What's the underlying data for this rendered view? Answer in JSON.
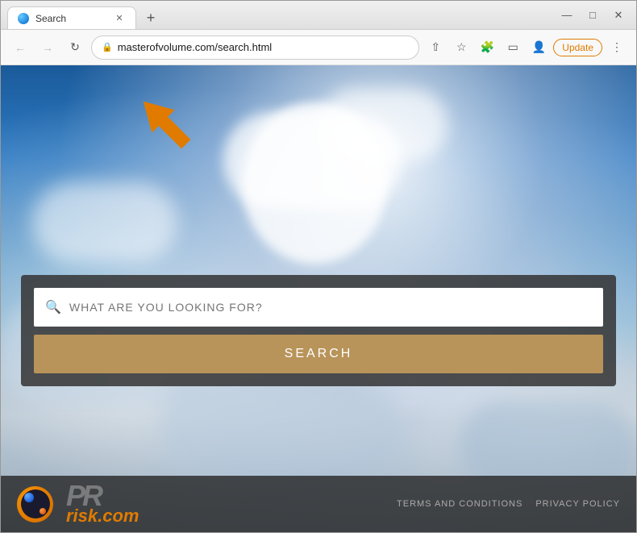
{
  "window": {
    "title": "Search",
    "tab_label": "Search"
  },
  "browser": {
    "back_label": "←",
    "forward_label": "→",
    "reload_label": "↻",
    "address": "masterofvolume.com/search.html",
    "update_label": "Update",
    "new_tab_label": "+"
  },
  "page": {
    "search_placeholder": "WHAT ARE YOU LOOKING FOR?",
    "search_button_label": "SEARCH"
  },
  "footer": {
    "terms_label": "TERMS AND CONDITIONS",
    "privacy_label": "PRIVACY POLICY",
    "brand_pr": "PR",
    "brand_risk": "risk.com"
  },
  "colors": {
    "search_btn": "#b8945a",
    "accent": "#e07b00"
  }
}
